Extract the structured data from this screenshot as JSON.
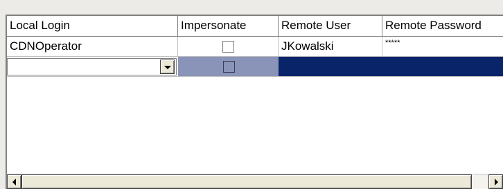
{
  "grid": {
    "columns": [
      "Local Login",
      "Impersonate",
      "Remote User",
      "Remote Password"
    ],
    "rows": [
      {
        "local_login": "CDNOperator",
        "impersonate": false,
        "remote_user": "JKowalski",
        "remote_password": "*****"
      },
      {
        "local_login": "",
        "impersonate": false,
        "remote_user": "",
        "remote_password": ""
      }
    ]
  },
  "icons": {
    "combo_dropdown": "chevron-down-icon",
    "scroll_left": "arrow-left-icon",
    "scroll_right": "arrow-right-icon"
  },
  "colors": {
    "selection": "#0a246a",
    "selection_light": "#8994b8",
    "header_bg": "#ece9d8"
  }
}
